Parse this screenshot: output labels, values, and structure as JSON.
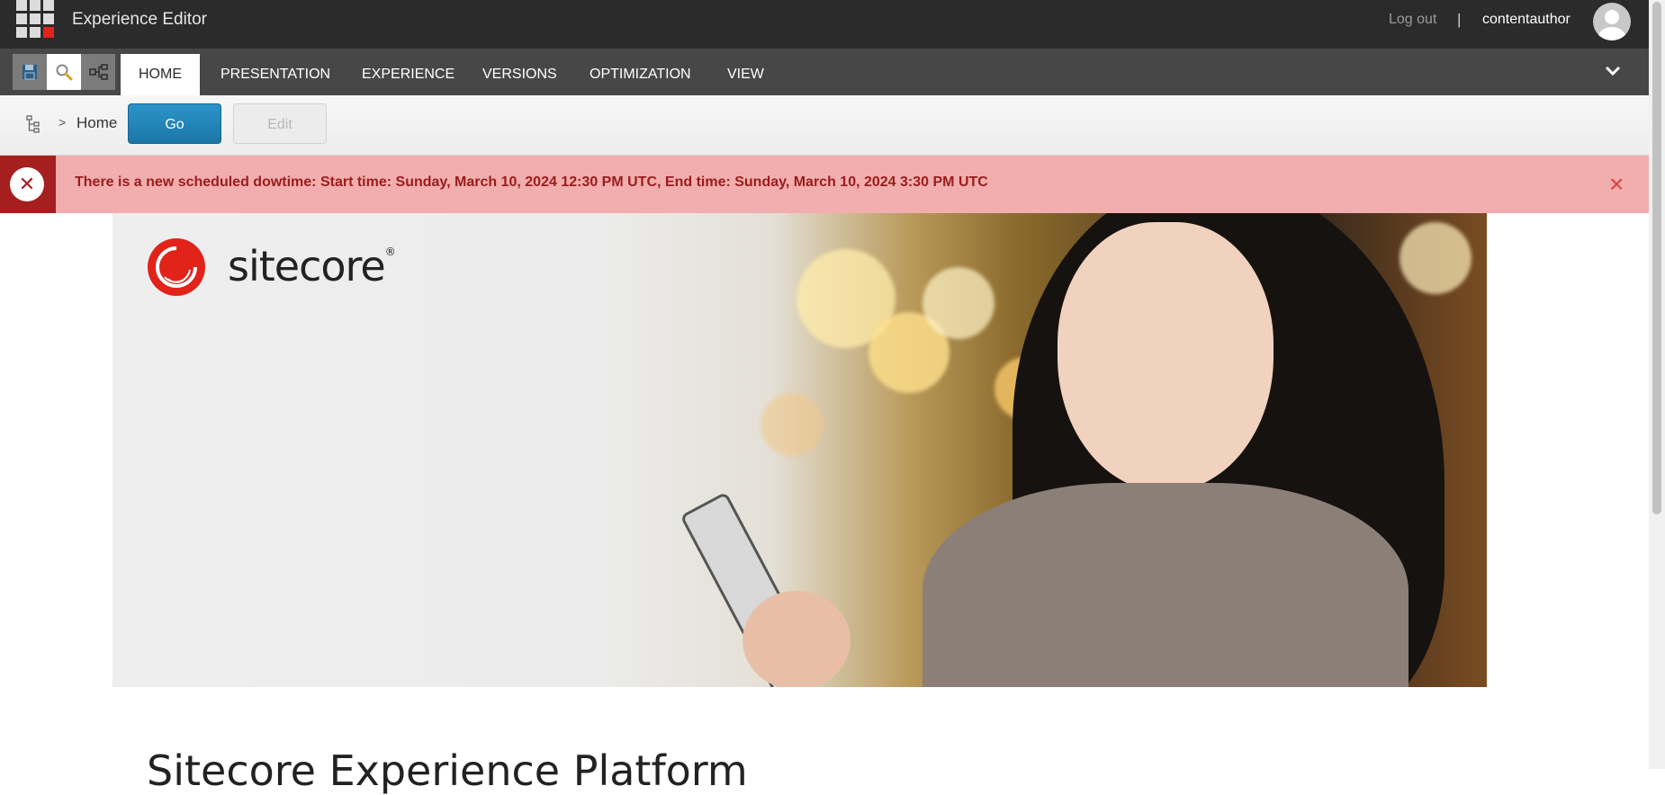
{
  "app": {
    "title": "Experience Editor"
  },
  "user": {
    "logout_label": "Log out",
    "separator": "|",
    "username": "contentauthor"
  },
  "quick_access": [
    {
      "name": "save",
      "icon": "save-icon"
    },
    {
      "name": "search",
      "icon": "search-icon"
    },
    {
      "name": "navigate",
      "icon": "tree-structure-icon"
    }
  ],
  "ribbon": {
    "tabs": [
      {
        "label": "HOME",
        "active": true
      },
      {
        "label": "PRESENTATION",
        "active": false
      },
      {
        "label": "EXPERIENCE",
        "active": false
      },
      {
        "label": "VERSIONS",
        "active": false
      },
      {
        "label": "OPTIMIZATION",
        "active": false
      },
      {
        "label": "VIEW",
        "active": false
      }
    ],
    "toggle_icon": "chevron-down-icon"
  },
  "navbar": {
    "crumb_separator": ">",
    "crumb_home": "Home",
    "go_label": "Go",
    "edit_label": "Edit"
  },
  "alert": {
    "message": "There is a new scheduled dowtime: Start time: Sunday, March 10, 2024 12:30 PM UTC, End time: Sunday, March 10, 2024 3:30 PM UTC",
    "icon": "error-x-icon",
    "close": "×",
    "icon_glyph": "✕"
  },
  "hero": {
    "logo_text": "sitecore",
    "logo_mark": "®"
  },
  "page": {
    "heading": "Sitecore Experience Platform"
  },
  "colors": {
    "topbar": "#2b2b2b",
    "ribbon": "#474747",
    "go_button": "#1f80b5",
    "alert_bg": "#f2aeae",
    "alert_icon_bg": "#a51f1f",
    "brand_red": "#e2231a"
  }
}
